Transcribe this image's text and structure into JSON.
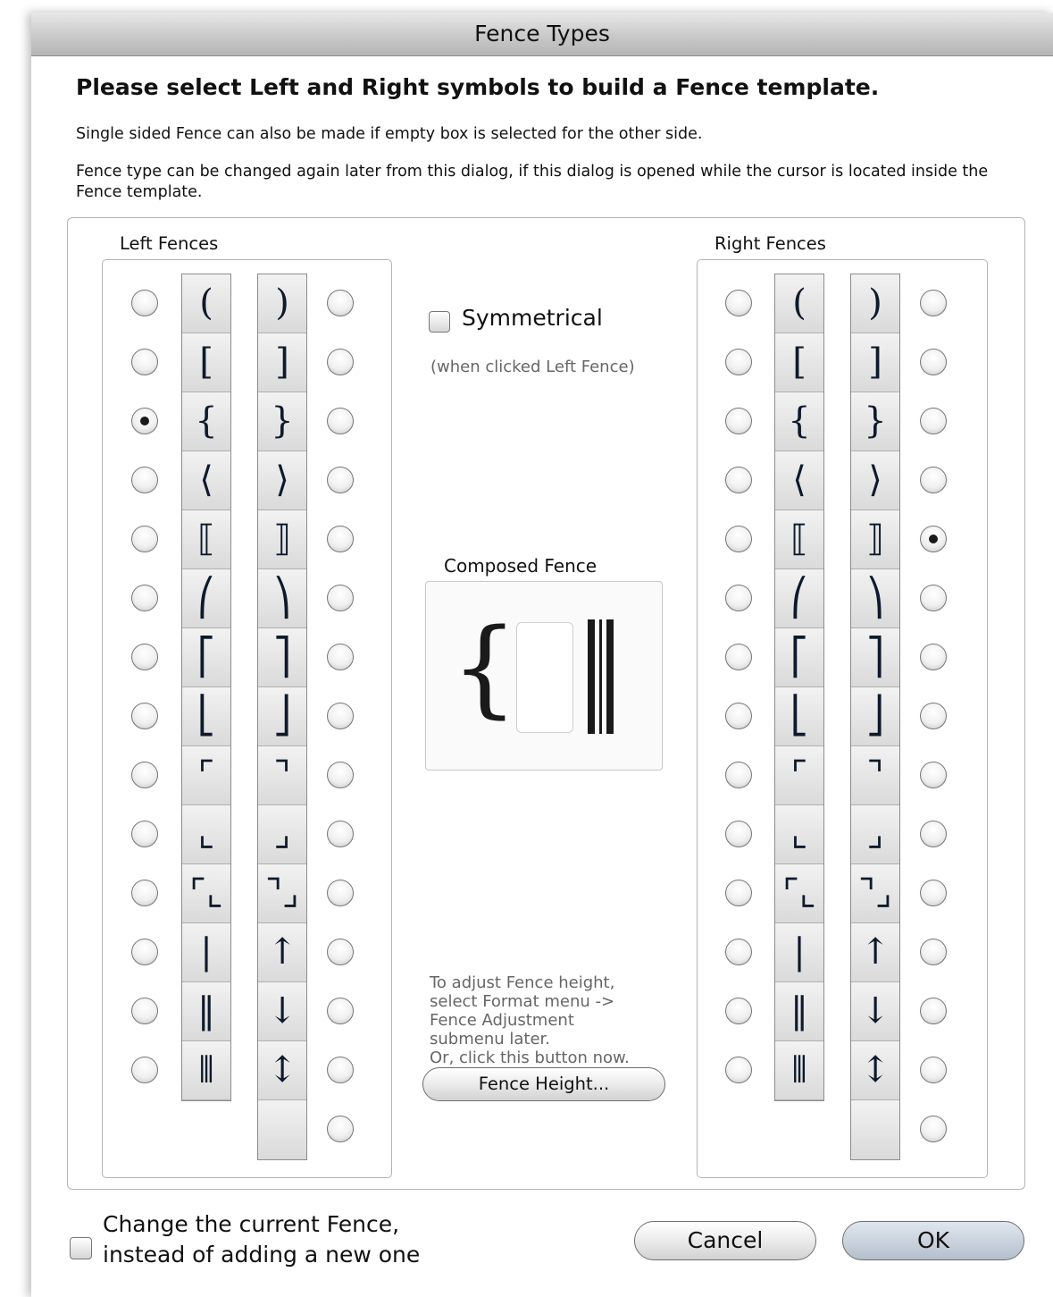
{
  "window": {
    "title": "Fence Types"
  },
  "instructions": {
    "heading": "Please select Left and Right symbols to build a Fence template.",
    "line1": "Single sided Fence can also be made if empty box is selected for the other side.",
    "line2": "Fence type can be changed again later from this dialog, if this dialog is opened while the cursor is located inside the Fence template."
  },
  "left_group": {
    "label": "Left Fences",
    "open_symbols": [
      "(",
      "[",
      "{",
      "⟨",
      "⟦",
      "⎛",
      "⎡",
      "⎣",
      "⌜",
      "⌞",
      "⌜⌞",
      "|",
      "‖",
      "⦀"
    ],
    "close_symbols": [
      ")",
      "]",
      "}",
      "⟩",
      "⟧",
      "⎞",
      "⎤",
      "⎦",
      "⌝",
      "⌟",
      "⌝⌟",
      "↑",
      "↓",
      "↕",
      ""
    ],
    "selected_column": "open",
    "selected_index": 2
  },
  "right_group": {
    "label": "Right Fences",
    "open_symbols": [
      "(",
      "[",
      "{",
      "⟨",
      "⟦",
      "⎛",
      "⎡",
      "⎣",
      "⌜",
      "⌞",
      "⌜⌞",
      "|",
      "‖",
      "⦀"
    ],
    "close_symbols": [
      ")",
      "]",
      "}",
      "⟩",
      "⟧",
      "⎞",
      "⎤",
      "⎦",
      "⌝",
      "⌟",
      "⌝⌟",
      "↑",
      "↓",
      "↕",
      ""
    ],
    "selected_column": "close",
    "selected_index": 4
  },
  "symmetrical": {
    "label": "Symmetrical",
    "checked": false,
    "note": "(when clicked Left Fence)"
  },
  "composed_fence": {
    "label": "Composed Fence",
    "left_symbol": "{",
    "right_symbol": "⟧"
  },
  "adjust_note": "To adjust Fence height,\nselect Format menu ->\nFence Adjustment\nsubmenu later.\nOr, click this button now.",
  "buttons": {
    "fence_height": "Fence Height...",
    "cancel": "Cancel",
    "ok": "OK"
  },
  "change_current": {
    "label": "Change the current Fence,\ninstead of adding a new one",
    "checked": false
  }
}
